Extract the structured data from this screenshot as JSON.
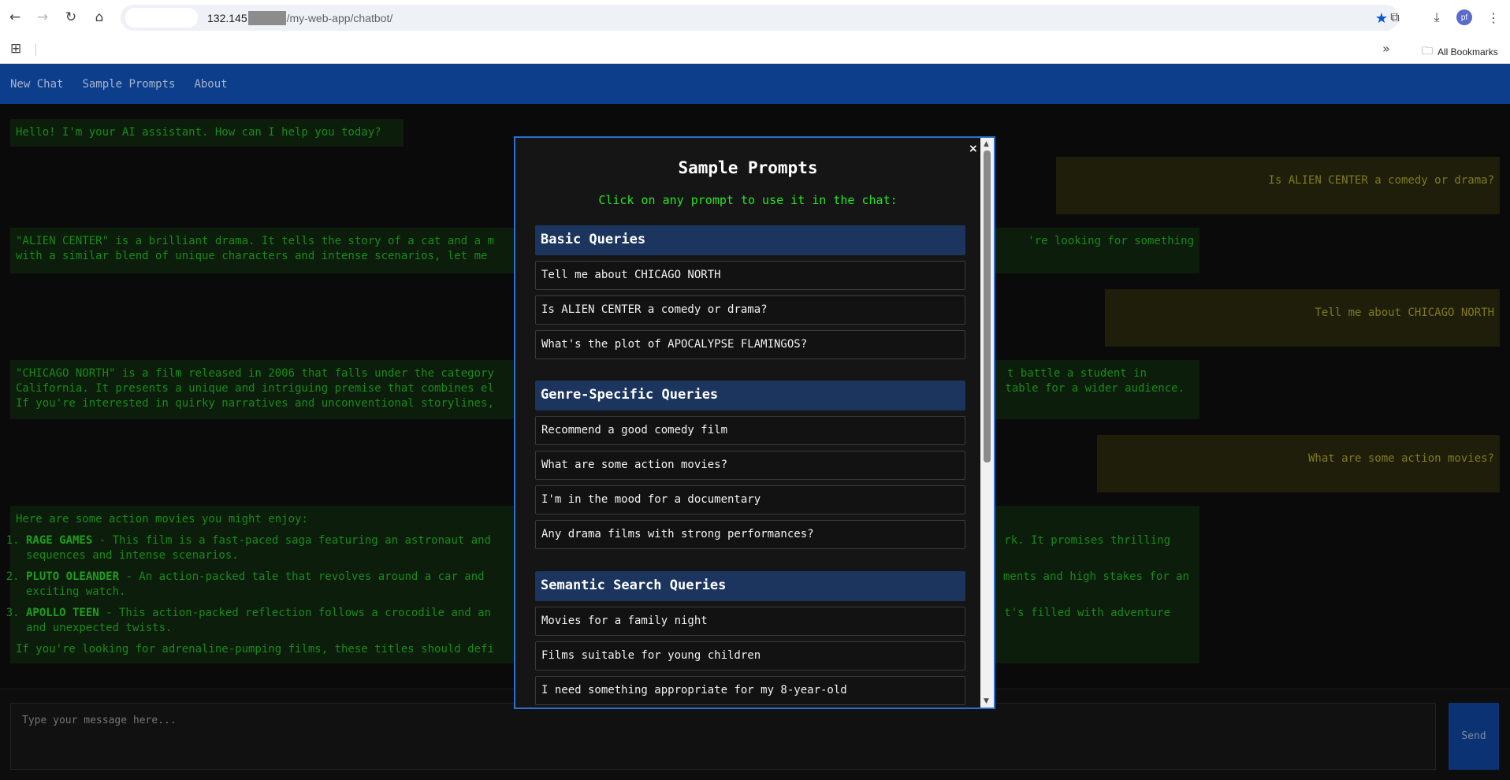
{
  "browser": {
    "url_host": "132.145",
    "url_path": "/my-web-app/chatbot/",
    "profile_initials": "pf",
    "all_bookmarks": "All Bookmarks"
  },
  "nav": {
    "new_chat": "New Chat",
    "sample_prompts": "Sample Prompts",
    "about": "About"
  },
  "chat": {
    "greeting": "Hello! I'm your AI assistant. How can I help you today?",
    "user1": "Is ALIEN CENTER a comedy or drama?",
    "bot1_left": "\"ALIEN CENTER\" is a brilliant drama. It tells the story of a cat and a m",
    "bot1_right": "'re looking for something",
    "bot1_line2_left": "with a similar blend of unique characters and intense scenarios, let me",
    "user2": "Tell me about CHICAGO NORTH",
    "bot2_l1_left": "\"CHICAGO NORTH\" is a film released in 2006 that falls under the category",
    "bot2_l1_right": "t battle a student in",
    "bot2_l2_left": "California. It presents a unique and intriguing premise that combines el",
    "bot2_l2_right": "table for a wider audience.",
    "bot2_l3_left": "If you're interested in quirky narratives and unconventional storylines,",
    "user3": "What are some action movies?",
    "bot3_intro": "Here are some action movies you might enjoy:",
    "bot3_items": [
      {
        "title": "RAGE GAMES",
        "left": " - This film is a fast-paced saga featuring an astronaut and",
        "right": "rk. It promises thrilling",
        "cont": "sequences and intense scenarios."
      },
      {
        "title": "PLUTO OLEANDER",
        "left": " - An action-packed tale that revolves around a car and",
        "right": "ments and high stakes for an",
        "cont": "exciting watch."
      },
      {
        "title": "APOLLO TEEN",
        "left": " - This action-packed reflection follows a crocodile and an",
        "right": "t's filled with adventure",
        "cont": "and unexpected twists."
      }
    ],
    "bot3_outro": "If you're looking for adrenaline-pumping films, these titles should defi"
  },
  "input": {
    "placeholder": "Type your message here...",
    "send_label": "Send"
  },
  "modal": {
    "close": "×",
    "title": "Sample Prompts",
    "subtitle": "Click on any prompt to use it in the chat:",
    "sections": [
      {
        "header": "Basic Queries",
        "prompts": [
          "Tell me about CHICAGO NORTH",
          "Is ALIEN CENTER a comedy or drama?",
          "What's the plot of APOCALYPSE FLAMINGOS?"
        ]
      },
      {
        "header": "Genre-Specific Queries",
        "prompts": [
          "Recommend a good comedy film",
          "What are some action movies?",
          "I'm in the mood for a documentary",
          "Any drama films with strong performances?"
        ]
      },
      {
        "header": "Semantic Search Queries",
        "prompts": [
          "Movies for a family night",
          "Films suitable for young children",
          "I need something appropriate for my 8-year-old"
        ]
      }
    ]
  }
}
